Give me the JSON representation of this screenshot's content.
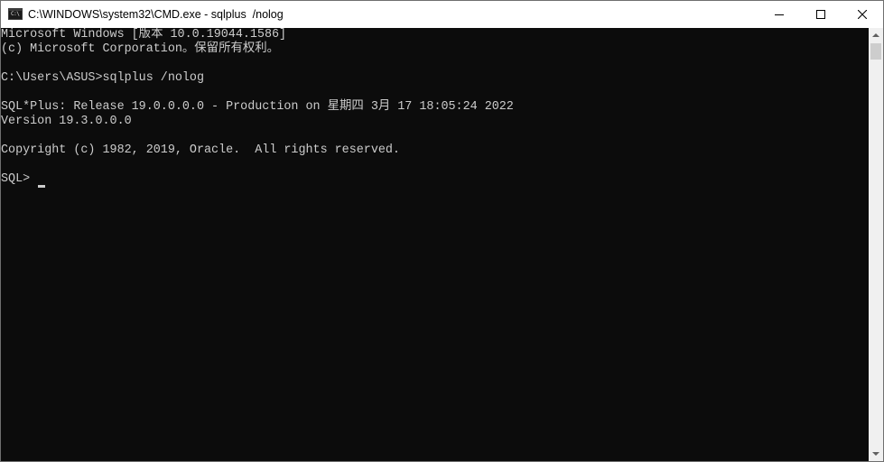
{
  "window": {
    "title": "C:\\WINDOWS\\system32\\CMD.exe - sqlplus  /nolog",
    "icon": "cmd-icon",
    "icon_text": "C:\\",
    "buttons": {
      "minimize": "minimize-icon",
      "maximize": "maximize-icon",
      "close": "close-icon"
    }
  },
  "console": {
    "lines": [
      "Microsoft Windows [版本 10.0.19044.1586]",
      "(c) Microsoft Corporation。保留所有权利。",
      "",
      "C:\\Users\\ASUS>sqlplus /nolog",
      "",
      "SQL*Plus: Release 19.0.0.0.0 - Production on 星期四 3月 17 18:05:24 2022",
      "Version 19.3.0.0.0",
      "",
      "Copyright (c) 1982, 2019, Oracle.  All rights reserved.",
      "",
      "SQL> "
    ]
  },
  "colors": {
    "background": "#0c0c0c",
    "text": "#cccccc",
    "titlebar": "#ffffff"
  }
}
